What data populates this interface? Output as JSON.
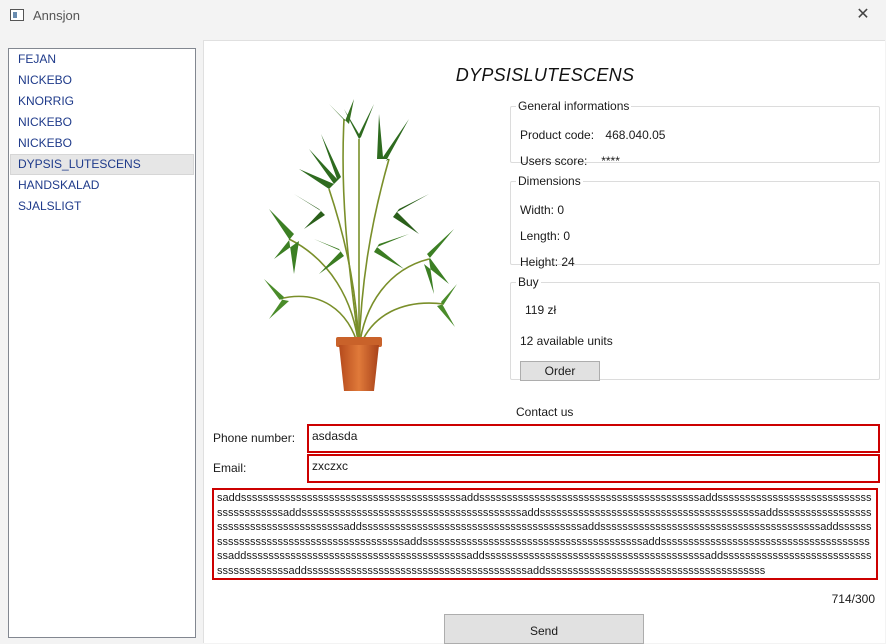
{
  "window": {
    "title": "Annsjon",
    "close_glyph": "✕"
  },
  "products": [
    {
      "label": "FEJAN"
    },
    {
      "label": "NICKEBO"
    },
    {
      "label": "KNORRIG"
    },
    {
      "label": "NICKEBO"
    },
    {
      "label": "NICKEBO"
    },
    {
      "label": "DYPSIS_LUTESCENS",
      "selected": true
    },
    {
      "label": "HANDSKALAD"
    },
    {
      "label": "SJALSLIGT"
    }
  ],
  "detail": {
    "title": "DYPSISLUTESCENS",
    "image_icon": "potted-palm-plant",
    "general": {
      "legend": "General informations",
      "product_code_label": "Product code:",
      "product_code": "468.040.05",
      "users_score_label": "Users score:",
      "users_score": "****"
    },
    "dimensions": {
      "legend": "Dimensions",
      "width": "Width: 0",
      "length": "Length: 0",
      "height": "Height: 24"
    },
    "buy": {
      "legend": "Buy",
      "price": "119 zł",
      "availability": "12 available units",
      "order_label": "Order"
    }
  },
  "contact": {
    "heading": "Contact us",
    "phone_label": "Phone number:",
    "phone_value": "asdasda",
    "email_label": "Email:",
    "email_value": "zxczxc",
    "message_value": "saddssssssssssssssssssssssssssssssssssssssssaddssssssssssssssssssssssssssssssssssssssssaddssssssssssssssssssssssssssssssssssssssssaddssssssssssssssssssssssssssssssssssssssssaddssssssssssssssssssssssssssssssssssssssssaddssssssssssssssssssssssssssssssssssssssssaddssssssssssssssssssssssssssssssssssssssssaddssssssssssssssssssssssssssssssssssssssssaddssssssssssssssssssssssssssssssssssssssssaddssssssssssssssssssssssssssssssssssssssssaddssssssssssssssssssssssssssssssssssssssssaddssssssssssssssssssssssssssssssssssssssssaddssssssssssssssssssssssssssssssssssssssssaddssssssssssssssssssssssssssssssssssssssssaddssssssssssssssssssssssssssssssssssssssssaddssssssssssssssssssssssssssssssssssssssss",
    "counter": "714/300",
    "send_label": "Send"
  },
  "colors": {
    "error_border": "#cc0000",
    "list_text": "#1e3a8a",
    "selected_bg": "#e6e6e6"
  }
}
